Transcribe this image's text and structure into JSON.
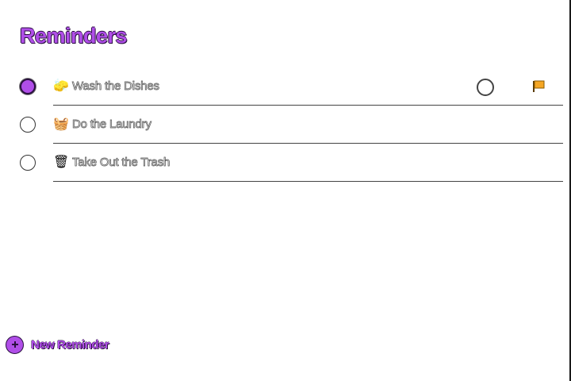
{
  "app": {
    "title": "Reminders",
    "accent_color": "#b04ee8"
  },
  "reminders": [
    {
      "emoji": "🧽",
      "emoji_icon": "sponge-icon",
      "label": "Wash the Dishes",
      "selected": true
    },
    {
      "emoji": "🧺",
      "emoji_icon": "laundry-basket-icon",
      "label": "Do the Laundry",
      "selected": false
    },
    {
      "emoji": "🗑",
      "emoji_icon": "trash-can-icon",
      "label": "Take Out the Trash",
      "selected": false
    }
  ],
  "row_actions": {
    "info_icon": "info-circle-icon",
    "flag_icon": "flag-icon",
    "flag_color": "#f5a623"
  },
  "footer": {
    "new_reminder_label": "New Reminder",
    "new_reminder_icon": "plus-circle-icon"
  }
}
